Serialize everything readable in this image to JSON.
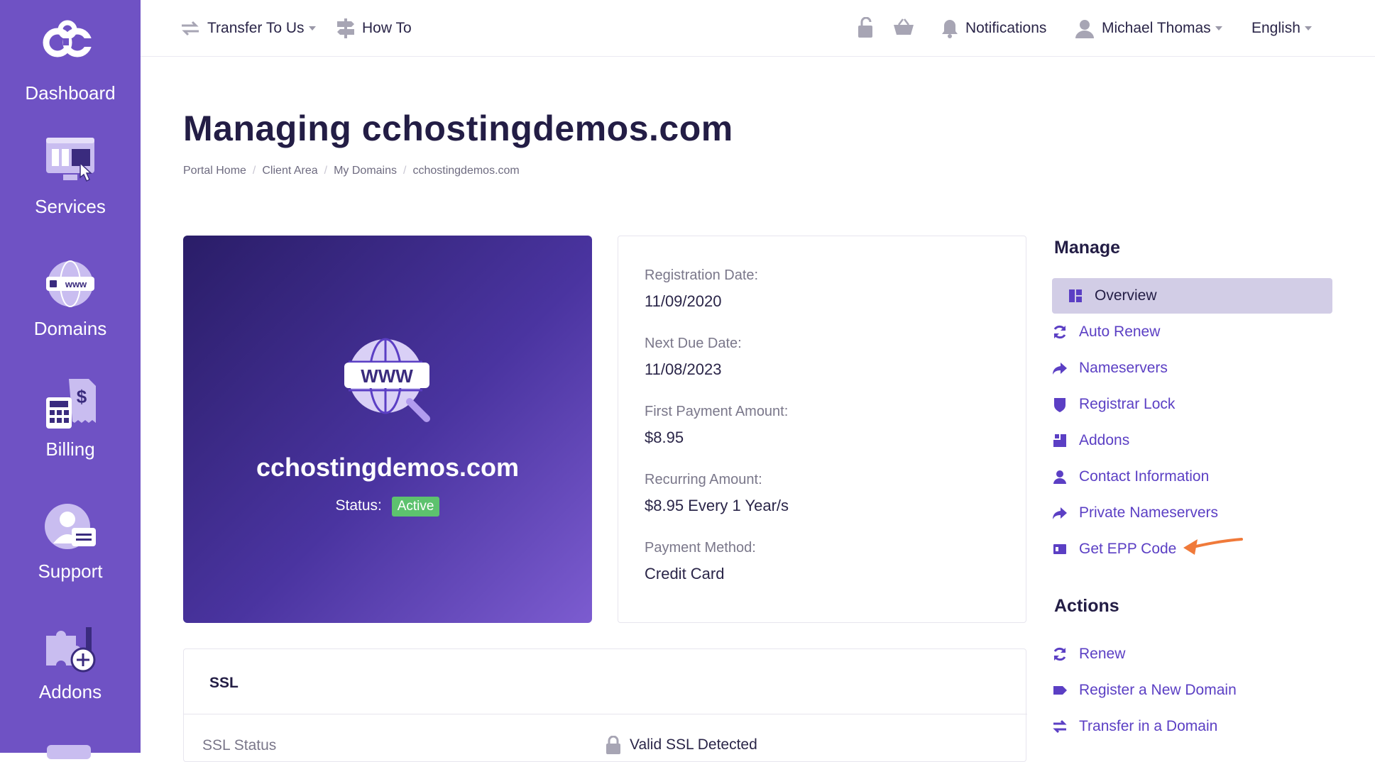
{
  "sidebar": {
    "items": [
      {
        "label": "Dashboard"
      },
      {
        "label": "Services"
      },
      {
        "label": "Domains"
      },
      {
        "label": "Billing"
      },
      {
        "label": "Support"
      },
      {
        "label": "Addons"
      }
    ]
  },
  "topbar": {
    "transfer_label": "Transfer To Us",
    "howto_label": "How To",
    "notifications_label": "Notifications",
    "user_label": "Michael Thomas",
    "language_label": "English"
  },
  "page": {
    "title": "Managing cchostingdemos.com",
    "breadcrumb": [
      "Portal Home",
      "Client Area",
      "My Domains",
      "cchostingdemos.com"
    ]
  },
  "domain_card": {
    "domain": "cchostingdemos.com",
    "www_text": "WWW",
    "status_label": "Status:",
    "status_value": "Active"
  },
  "info": {
    "registration_label": "Registration Date:",
    "registration_value": "11/09/2020",
    "next_due_label": "Next Due Date:",
    "next_due_value": "11/08/2023",
    "first_payment_label": "First Payment Amount:",
    "first_payment_value": "$8.95",
    "recurring_label": "Recurring Amount:",
    "recurring_value": "$8.95 Every 1 Year/s",
    "payment_method_label": "Payment Method:",
    "payment_method_value": "Credit Card"
  },
  "ssl": {
    "heading": "SSL",
    "status_label": "SSL Status",
    "status_value": "Valid SSL Detected"
  },
  "manage": {
    "title": "Manage",
    "items": [
      {
        "label": "Overview"
      },
      {
        "label": "Auto Renew"
      },
      {
        "label": "Nameservers"
      },
      {
        "label": "Registrar Lock"
      },
      {
        "label": "Addons"
      },
      {
        "label": "Contact Information"
      },
      {
        "label": "Private Nameservers"
      },
      {
        "label": "Get EPP Code"
      }
    ]
  },
  "actions": {
    "title": "Actions",
    "items": [
      {
        "label": "Renew"
      },
      {
        "label": "Register a New Domain"
      },
      {
        "label": "Transfer in a Domain"
      }
    ]
  },
  "colors": {
    "sidebar": "#6f52c4",
    "accent": "#5b3fc4",
    "active_badge": "#5dc26e",
    "annotation_arrow": "#f07a3a"
  }
}
